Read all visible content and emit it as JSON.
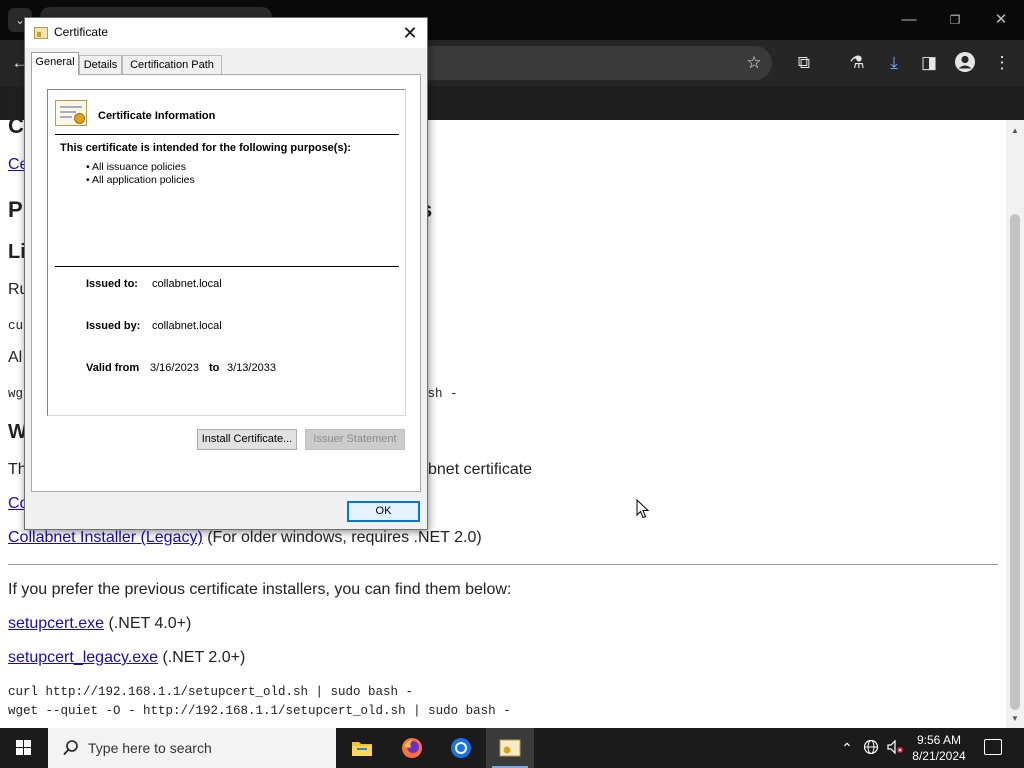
{
  "dialog": {
    "title": "Certificate",
    "tabs": [
      "General",
      "Details",
      "Certification Path"
    ],
    "heading": "Certificate Information",
    "purpose_title": "This certificate is intended for the following purpose(s):",
    "purposes": [
      "• All issuance policies",
      "• All application policies"
    ],
    "issued_to_label": "Issued to:",
    "issued_to": "collabnet.local",
    "issued_by_label": "Issued by:",
    "issued_by": "collabnet.local",
    "valid_from_label": "Valid from",
    "valid_from": "3/16/2023",
    "valid_to_label": "to",
    "valid_to": "3/13/2033",
    "install_button": "Install Certificate...",
    "issuer_button": "Issuer Statement",
    "ok_button": "OK"
  },
  "page": {
    "heading_partial": "C",
    "link_partial": "Ce",
    "heading2_partial_left": "P",
    "heading2_partial_right": "s",
    "heading3_partial": "Li",
    "text_run_partial": "Ru",
    "code_partial": "cu",
    "text_alt_partial": "Al",
    "wget_partial_left": "wg",
    "wget_partial_right": "ash -",
    "heading4_partial": "W",
    "text_th_partial": "Th",
    "text_cert_partial": "bnet certificate",
    "link_co_partial": "Co",
    "legacy_link": "Collabnet Installer (Legacy)",
    "legacy_note": " (For older windows, requires .NET 2.0)",
    "prev_text": "If you prefer the previous certificate installers, you can find them below:",
    "setup_link": "setupcert.exe",
    "setup_note": " (.NET 4.0+)",
    "setup_legacy_link": "setupcert_legacy.exe",
    "setup_legacy_note": " (.NET 2.0+)",
    "curl_cmd": "curl http://192.168.1.1/setupcert_old.sh | sudo bash -",
    "wget_cmd": "wget --quiet -O - http://192.168.1.1/setupcert_old.sh | sudo bash -"
  },
  "taskbar": {
    "search_placeholder": "Type here to search",
    "time": "9:56 AM",
    "date": "8/21/2024"
  },
  "colors": {
    "link": "#1a0dab",
    "ok_border": "#0078d7",
    "taskbar": "#1b1b1b"
  }
}
